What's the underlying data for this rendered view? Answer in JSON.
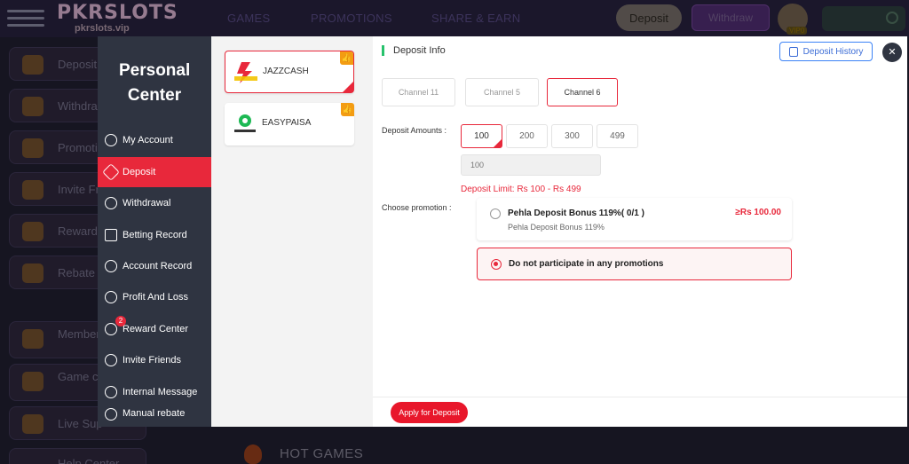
{
  "brand": {
    "name": "PKRSLOTS",
    "domain": "pkrslots.vip"
  },
  "nav": [
    "GAMES",
    "PROMOTIONS",
    "SHARE & EARN"
  ],
  "header": {
    "deposit_label": "Deposit",
    "withdraw_label": "Withdraw",
    "vip_label": "VIP0"
  },
  "sidebar": [
    {
      "label": "Deposit"
    },
    {
      "label": "Withdra"
    },
    {
      "label": "Promotio"
    },
    {
      "label": "Invite Fr"
    },
    {
      "label": "Reward"
    },
    {
      "label": "Rebate"
    },
    {
      "label": "Member Center"
    },
    {
      "label": "Game center"
    },
    {
      "label": "Live Sup"
    }
  ],
  "hot_games_label": "HOT GAMES",
  "help_center_label": "Help Center",
  "personal_center": {
    "title": "Personal Center",
    "items": [
      {
        "label": "My Account",
        "icon": "account-icon"
      },
      {
        "label": "Deposit",
        "icon": "deposit-icon",
        "active": true
      },
      {
        "label": "Withdrawal",
        "icon": "withdrawal-icon"
      },
      {
        "label": "Betting Record",
        "icon": "betting-record-icon"
      },
      {
        "label": "Account Record",
        "icon": "account-record-icon"
      },
      {
        "label": "Profit And Loss",
        "icon": "profit-loss-icon"
      },
      {
        "label": "Reward Center",
        "icon": "reward-icon",
        "badge": "2"
      },
      {
        "label": "Invite Friends",
        "icon": "invite-icon"
      },
      {
        "label": "Internal Message",
        "icon": "message-icon"
      },
      {
        "label": "Manual rebate",
        "icon": "rebate-icon"
      }
    ]
  },
  "payment_methods": [
    {
      "name": "JAZZCASH",
      "selected": true
    },
    {
      "name": "EASYPAISA",
      "selected": false
    }
  ],
  "deposit": {
    "title": "Deposit Info",
    "history_label": "Deposit History",
    "channels": [
      "Channel 11",
      "Channel 5",
      "Channel 6"
    ],
    "selected_channel": "Channel 6",
    "amounts_label": "Deposit Amounts :",
    "amounts": [
      "100",
      "200",
      "300",
      "499"
    ],
    "selected_amount": "100",
    "amount_input_value": "100",
    "limit_text": "Deposit Limit:  Rs  100  - Rs  499",
    "promotion_label": "Choose promotion :",
    "promotions": [
      {
        "name": "Pehla Deposit Bonus 119%( 0/1 )",
        "sub": "Pehla Deposit Bonus 119%",
        "amount": "≥Rs  100.00",
        "selected": false
      },
      {
        "name": "Do not participate in any promotions",
        "selected": true
      }
    ],
    "apply_label": "Apply for Deposit"
  },
  "colors": {
    "accent": "#e8283b",
    "panel": "#2f3441",
    "info_blue": "#3b82f6",
    "info_green": "#27c26c"
  }
}
